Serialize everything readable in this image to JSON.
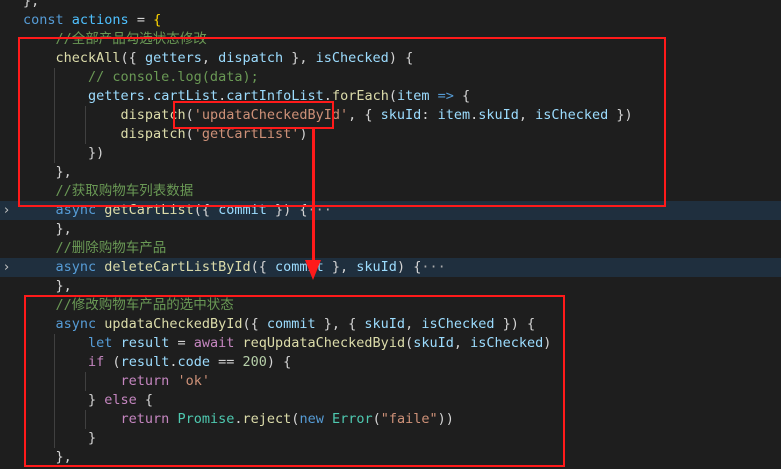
{
  "editor": {
    "lines": [
      {
        "tokens": [
          {
            "t": "};",
            "c": "pun"
          }
        ]
      },
      {
        "tokens": [
          {
            "t": "const ",
            "c": "kw"
          },
          {
            "t": "actions",
            "c": "cst"
          },
          {
            "t": " = ",
            "c": "pun"
          },
          {
            "t": "{",
            "c": "brk"
          }
        ]
      },
      {
        "tokens": [
          {
            "t": "    //全部产品勾选状态修改",
            "c": "com"
          }
        ]
      },
      {
        "tokens": [
          {
            "t": "    ",
            "c": "pun"
          },
          {
            "t": "checkAll",
            "c": "fn"
          },
          {
            "t": "({ ",
            "c": "pun"
          },
          {
            "t": "getters",
            "c": "var"
          },
          {
            "t": ", ",
            "c": "pun"
          },
          {
            "t": "dispatch",
            "c": "var"
          },
          {
            "t": " }, ",
            "c": "pun"
          },
          {
            "t": "isChecked",
            "c": "var"
          },
          {
            "t": ") {",
            "c": "pun"
          }
        ]
      },
      {
        "tokens": [
          {
            "t": "        // console.log(data);",
            "c": "com"
          }
        ]
      },
      {
        "tokens": [
          {
            "t": "        ",
            "c": "pun"
          },
          {
            "t": "getters",
            "c": "var"
          },
          {
            "t": ".",
            "c": "pun"
          },
          {
            "t": "cartList",
            "c": "var"
          },
          {
            "t": ".",
            "c": "pun"
          },
          {
            "t": "cartInfoList",
            "c": "var"
          },
          {
            "t": ".",
            "c": "pun"
          },
          {
            "t": "forEach",
            "c": "fn"
          },
          {
            "t": "(",
            "c": "pun"
          },
          {
            "t": "item",
            "c": "var"
          },
          {
            "t": " ",
            "c": "pun"
          },
          {
            "t": "=>",
            "c": "kw"
          },
          {
            "t": " {",
            "c": "pun"
          }
        ]
      },
      {
        "tokens": [
          {
            "t": "            ",
            "c": "pun"
          },
          {
            "t": "dispatch",
            "c": "fn"
          },
          {
            "t": "(",
            "c": "pun"
          },
          {
            "t": "'updataCheckedById'",
            "c": "str"
          },
          {
            "t": ", { ",
            "c": "pun"
          },
          {
            "t": "skuId",
            "c": "var"
          },
          {
            "t": ": ",
            "c": "pun"
          },
          {
            "t": "item",
            "c": "var"
          },
          {
            "t": ".",
            "c": "pun"
          },
          {
            "t": "skuId",
            "c": "var"
          },
          {
            "t": ", ",
            "c": "pun"
          },
          {
            "t": "isChecked",
            "c": "var"
          },
          {
            "t": " })",
            "c": "pun"
          }
        ]
      },
      {
        "tokens": [
          {
            "t": "            ",
            "c": "pun"
          },
          {
            "t": "dispatch",
            "c": "fn"
          },
          {
            "t": "(",
            "c": "pun"
          },
          {
            "t": "'getCartList'",
            "c": "str"
          },
          {
            "t": ")",
            "c": "pun"
          }
        ]
      },
      {
        "tokens": [
          {
            "t": "        })",
            "c": "pun"
          }
        ]
      },
      {
        "tokens": [
          {
            "t": "    },",
            "c": "pun"
          }
        ]
      },
      {
        "tokens": [
          {
            "t": "    //获取购物车列表数据",
            "c": "com"
          }
        ]
      },
      {
        "fold": true,
        "tokens": [
          {
            "t": "    ",
            "c": "pun"
          },
          {
            "t": "async",
            "c": "kw"
          },
          {
            "t": " ",
            "c": "pun"
          },
          {
            "t": "getCartList",
            "c": "fn"
          },
          {
            "t": "({ ",
            "c": "pun"
          },
          {
            "t": "commit",
            "c": "var"
          },
          {
            "t": " }) {",
            "c": "pun"
          },
          {
            "t": "···",
            "c": "ellipsis"
          }
        ]
      },
      {
        "tokens": [
          {
            "t": "    },",
            "c": "pun"
          }
        ]
      },
      {
        "tokens": [
          {
            "t": "    //删除购物车产品",
            "c": "com"
          }
        ]
      },
      {
        "fold": true,
        "tokens": [
          {
            "t": "    ",
            "c": "pun"
          },
          {
            "t": "async",
            "c": "kw"
          },
          {
            "t": " ",
            "c": "pun"
          },
          {
            "t": "deleteCartListById",
            "c": "fn"
          },
          {
            "t": "({ ",
            "c": "pun"
          },
          {
            "t": "commit",
            "c": "var"
          },
          {
            "t": " }, ",
            "c": "pun"
          },
          {
            "t": "skuId",
            "c": "var"
          },
          {
            "t": ") {",
            "c": "pun"
          },
          {
            "t": "···",
            "c": "ellipsis"
          }
        ]
      },
      {
        "tokens": [
          {
            "t": "    },",
            "c": "pun"
          }
        ]
      },
      {
        "tokens": [
          {
            "t": "    //修改购物车产品的选中状态",
            "c": "com"
          }
        ]
      },
      {
        "tokens": [
          {
            "t": "    ",
            "c": "pun"
          },
          {
            "t": "async",
            "c": "kw"
          },
          {
            "t": " ",
            "c": "pun"
          },
          {
            "t": "updataCheckedById",
            "c": "fn"
          },
          {
            "t": "({ ",
            "c": "pun"
          },
          {
            "t": "commit",
            "c": "var"
          },
          {
            "t": " }, { ",
            "c": "pun"
          },
          {
            "t": "skuId",
            "c": "var"
          },
          {
            "t": ", ",
            "c": "pun"
          },
          {
            "t": "isChecked",
            "c": "var"
          },
          {
            "t": " }) {",
            "c": "pun"
          }
        ]
      },
      {
        "tokens": [
          {
            "t": "        ",
            "c": "pun"
          },
          {
            "t": "let",
            "c": "kw"
          },
          {
            "t": " ",
            "c": "pun"
          },
          {
            "t": "result",
            "c": "var"
          },
          {
            "t": " = ",
            "c": "pun"
          },
          {
            "t": "await",
            "c": "ctl"
          },
          {
            "t": " ",
            "c": "pun"
          },
          {
            "t": "reqUpdataCheckedByid",
            "c": "fn"
          },
          {
            "t": "(",
            "c": "pun"
          },
          {
            "t": "skuId",
            "c": "var"
          },
          {
            "t": ", ",
            "c": "pun"
          },
          {
            "t": "isChecked",
            "c": "var"
          },
          {
            "t": ")",
            "c": "pun"
          }
        ]
      },
      {
        "tokens": [
          {
            "t": "        ",
            "c": "pun"
          },
          {
            "t": "if",
            "c": "ctl"
          },
          {
            "t": " (",
            "c": "pun"
          },
          {
            "t": "result",
            "c": "var"
          },
          {
            "t": ".",
            "c": "pun"
          },
          {
            "t": "code",
            "c": "var"
          },
          {
            "t": " == ",
            "c": "pun"
          },
          {
            "t": "200",
            "c": "num"
          },
          {
            "t": ") {",
            "c": "pun"
          }
        ]
      },
      {
        "tokens": [
          {
            "t": "            ",
            "c": "pun"
          },
          {
            "t": "return",
            "c": "ctl"
          },
          {
            "t": " ",
            "c": "pun"
          },
          {
            "t": "'ok'",
            "c": "str"
          }
        ]
      },
      {
        "tokens": [
          {
            "t": "        } ",
            "c": "pun"
          },
          {
            "t": "else",
            "c": "ctl"
          },
          {
            "t": " {",
            "c": "pun"
          }
        ]
      },
      {
        "tokens": [
          {
            "t": "            ",
            "c": "pun"
          },
          {
            "t": "return",
            "c": "ctl"
          },
          {
            "t": " ",
            "c": "pun"
          },
          {
            "t": "Promise",
            "c": "cls"
          },
          {
            "t": ".",
            "c": "pun"
          },
          {
            "t": "reject",
            "c": "fn"
          },
          {
            "t": "(",
            "c": "pun"
          },
          {
            "t": "new",
            "c": "kw"
          },
          {
            "t": " ",
            "c": "pun"
          },
          {
            "t": "Error",
            "c": "cls"
          },
          {
            "t": "(",
            "c": "pun"
          },
          {
            "t": "\"faile\"",
            "c": "str"
          },
          {
            "t": "))",
            "c": "pun"
          }
        ]
      },
      {
        "tokens": [
          {
            "t": "        }",
            "c": "pun"
          }
        ]
      },
      {
        "tokens": [
          {
            "t": "    },",
            "c": "pun"
          }
        ]
      }
    ]
  },
  "annotation_color": "#ff1a1a"
}
